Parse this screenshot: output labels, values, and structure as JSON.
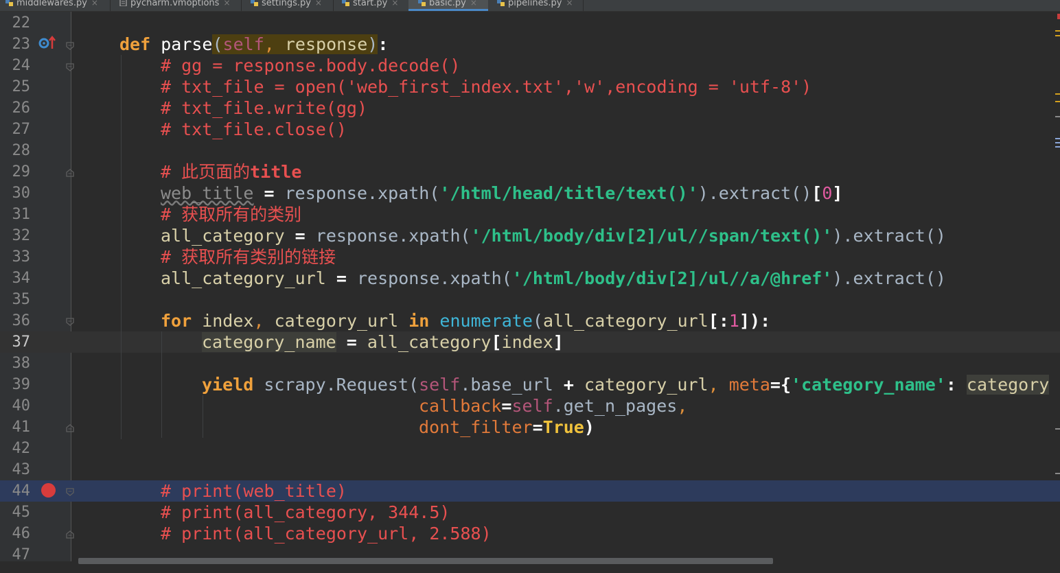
{
  "tabs": [
    {
      "name": "middlewares.py",
      "active": false
    },
    {
      "name": "pycharm.vmoptions",
      "active": false
    },
    {
      "name": "settings.py",
      "active": false
    },
    {
      "name": "start.py",
      "active": false
    },
    {
      "name": "basic.py",
      "active": true
    },
    {
      "name": "pipelines.py",
      "active": false
    }
  ],
  "tab_close_glyph": "×",
  "gutter": {
    "line_numbers": [
      "22",
      "23",
      "24",
      "25",
      "26",
      "27",
      "28",
      "29",
      "30",
      "31",
      "32",
      "33",
      "34",
      "35",
      "36",
      "37",
      "38",
      "39",
      "40",
      "41",
      "42",
      "43",
      "44",
      "45",
      "46",
      "47"
    ],
    "current_line": "37",
    "breakpoint_line": "44",
    "override_icon_line": "23",
    "icons": [
      "override-method-icon",
      "breakpoint-icon",
      "fold-marker-icon"
    ]
  },
  "code": {
    "l22": "",
    "l23": {
      "kw": "def",
      "name": "parse",
      "open": "(",
      "self": "self",
      "comma": ",",
      "param": " response",
      "close": ")",
      "colon": ":"
    },
    "l24": "# gg = response.body.decode()",
    "l25": "# txt_file = open('web_first_index.txt','w',encoding = 'utf-8')",
    "l26": "# txt_file.write(gg)",
    "l27": "# txt_file.close()",
    "l28": "",
    "l29": {
      "hash": "# 此页面的",
      "bold": "title"
    },
    "l30": {
      "var": "web_title",
      "eq": " = ",
      "call": "response.xpath(",
      "str": "'/html/head/title/text()'",
      "rest": ").extract()",
      "lb": "[",
      "idx": "0",
      "rb": "]"
    },
    "l31": "# 获取所有的类别",
    "l32": {
      "var": "all_category",
      "eq": " = ",
      "call": "response.xpath(",
      "str": "'/html/body/div[2]/ul//span/text()'",
      "rest": ").extract()"
    },
    "l33": "# 获取所有类别的链接",
    "l34": {
      "var": "all_category_url",
      "eq": " = ",
      "call": "response.xpath(",
      "str": "'/html/body/div[2]/ul//a/@href'",
      "rest": ").extract()"
    },
    "l35": "",
    "l36": {
      "kw_for": "for",
      "vars1": " index",
      "comma": ",",
      "vars2": " category_url ",
      "kw_in": "in",
      "sp": " ",
      "builtin": "enumerate",
      "open": "(",
      "arg": "all_category_url",
      "lb": "[",
      "colon": ":",
      "num": "1",
      "rb": "]",
      "close": "):"
    },
    "l37": {
      "var": "category_name",
      "eq": " = ",
      "rhs": "all_category",
      "lb": "[",
      "idx": "index",
      "rb": "]"
    },
    "l38": "",
    "l39": {
      "kw": "yield",
      "call": " scrapy.Request(",
      "self": "self",
      "attr": ".base_url ",
      "plus": "+",
      "arg": " category_url",
      "comma": ",",
      "sp": " ",
      "kwarg": "meta",
      "eq": "=",
      "lbrace": "{",
      "str": "'category_name'",
      "colon": ": ",
      "val": "category"
    },
    "l40": {
      "kwarg": "callback",
      "eq": "=",
      "self": "self",
      "attr": ".get_n_pages",
      "comma": ","
    },
    "l41": {
      "kwarg": "dont_filter",
      "eq": "=",
      "val": "True",
      "close": ")"
    },
    "l42": "",
    "l43": "",
    "l44": "# print(web_title)",
    "l45": "# print(all_category, 344.5)",
    "l46": "# print(all_category_url, 2.588)",
    "l47": ""
  },
  "colors": {
    "background": "#2b2b2b",
    "keyword": "#f0a13c",
    "comment": "#e85050",
    "string": "#2ec08a",
    "self": "#b4567a",
    "breakpoint_line": "#2d3b5c",
    "breakpoint": "#d73c3c"
  }
}
